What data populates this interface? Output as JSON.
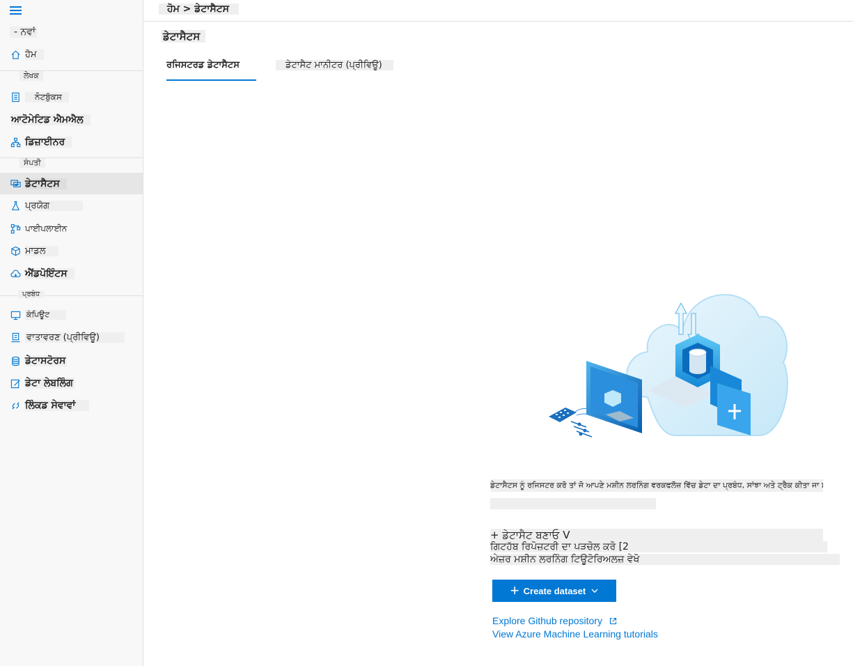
{
  "breadcrumb": "ਹੋਮ > ਡੇਟਾਸੈਟਸ",
  "page_title": "ਡੇਟਾਸੈਟਸ",
  "tabs": [
    {
      "label": "ਰਜਿਸਟਰਡ ਡੇਟਾਸੈਟਸ",
      "active": true
    },
    {
      "label": "ਡੇਟਾਸੈਟ ਮਾਨੀਟਰ (ਪ੍ਰੀਵਿਊ)",
      "active": false
    }
  ],
  "sidebar": {
    "new_label": "- ਨਵਾਂ",
    "home": "ਹੋਮ",
    "section_author": "ਲੇਖਕ",
    "notebooks": "ਨੋਟਬੁੱਕਸ",
    "automl": "ਆਟੋਮੇਟਿਡ ਐਮਐਲ",
    "designer": "ਡਿਜ਼ਾਈਨਰ",
    "section_assets": "ਸੰਪਤੀ",
    "datasets": "ਡੇਟਾਸੈਟਸ",
    "experiments": "ਪ੍ਰਯੋਗ",
    "pipelines": "ਪਾਈਪਲਾਈਨ",
    "models": "ਮਾਡਲ",
    "endpoints": "ਐਂਡਪੋਇੰਟਸ",
    "section_manage": "ਪ੍ਰਬੰਧ",
    "compute": "ਕੰਪਿਊਟ",
    "environments": "ਵਾਤਾਵਰਣ (ਪ੍ਰੀਵਿਊ)",
    "datastores": "ਡੇਟਾਸਟੋਰਸ",
    "data_labeling": "ਡੇਟਾ ਲੇਬਲਿੰਗ",
    "linked_services": "ਲਿੰਕਡ ਸੇਵਾਵਾਂ"
  },
  "empty_state": {
    "description": "ਡੇਟਾਸੈਟਸ ਨੂੰ ਰਜਿਸਟਰ ਕਰੋ ਤਾਂ ਜੋ ਆਪਣੇ ਮਸ਼ੀਨ ਲਰਨਿੰਗ ਵਰਕਫਲੋਜ਼ ਵਿੱਚ ਡੇਟਾ ਦਾ ਪ੍ਰਬੰਧ, ਸਾਂਝਾ ਅਤੇ ਟ੍ਰੈਕ ਕੀਤਾ ਜਾ ਸਕੇ।",
    "create_pa": "+ ਡੇਟਾਸੈਟ ਬਣਾਓ V",
    "explore_pa": "ਗਿਟਹੱਬ ਰਿਪੋਜ਼ਟਰੀ ਦਾ ਪੜਚੋਲ ਕਰੋ [2",
    "tutorials_pa": "ਅੇਜ਼ਰ ਮਸ਼ੀਨ ਲਰਨਿੰਗ ਟਿਊਟੋਰਿਅਲਜ਼ ਵੇਖੋ",
    "create_button": "Create dataset",
    "explore_link": "Explore Github repository",
    "tutorials_link": "View Azure Machine Learning tutorials"
  },
  "colors": {
    "accent": "#0078d4",
    "sidebar_bg": "#f8f8f8",
    "active_item": "#e6e6e6"
  }
}
